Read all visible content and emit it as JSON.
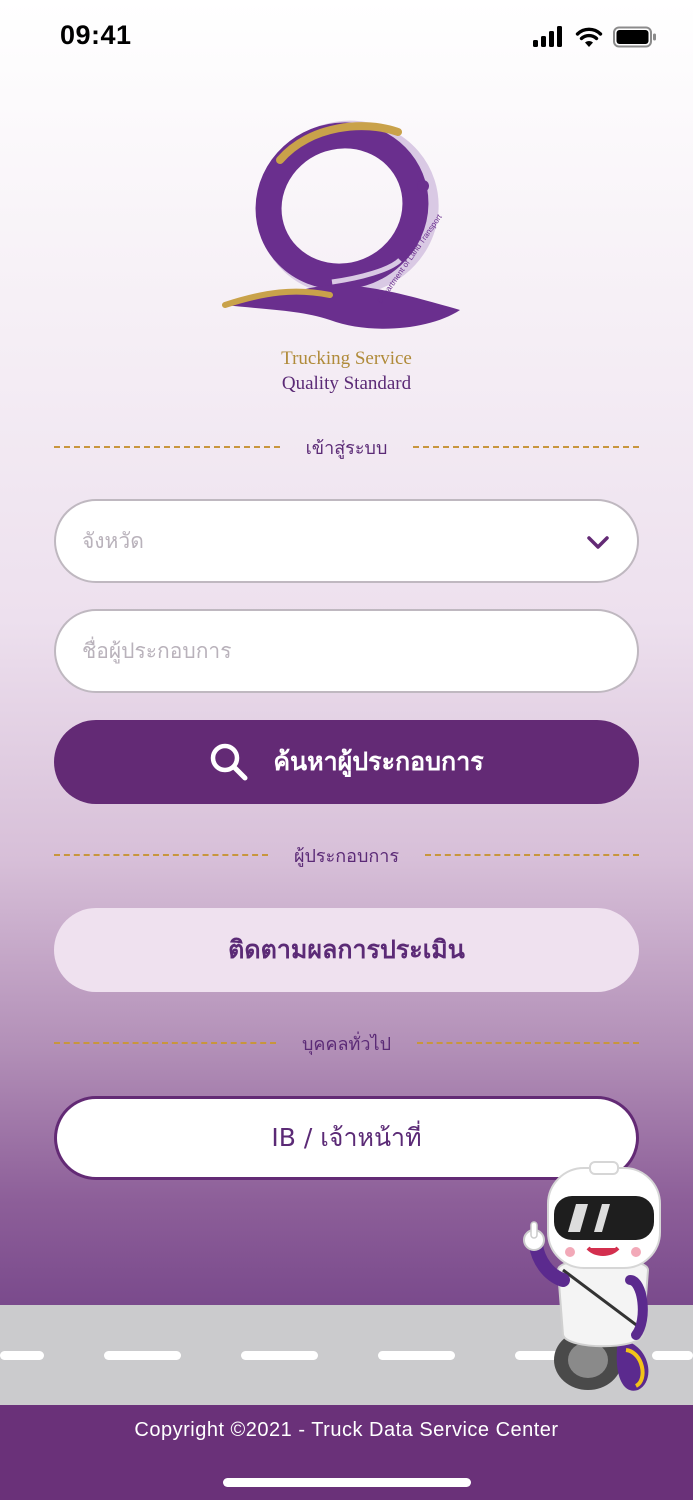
{
  "status_bar": {
    "time": "09:41"
  },
  "logo": {
    "ring_text": "Department of Land Transport",
    "caption_line1": "Trucking Service",
    "caption_line2": "Quality Standard"
  },
  "login_section": {
    "divider_label": "เข้าสู่ระบบ",
    "province_placeholder": "จังหวัด",
    "operator_placeholder": "ชื่อผู้ประกอบการ",
    "search_button_label": "ค้นหาผู้ประกอบการ"
  },
  "operator_section": {
    "divider_label": "ผู้ประกอบการ",
    "track_button_label": "ติดตามผลการประเมิน"
  },
  "public_section": {
    "divider_label": "บุคคลทั่วไป",
    "ib_button_label": "IB / เจ้าหน้าที่"
  },
  "footer": {
    "copyright": "Copyright ©2021 - Truck Data Service Center"
  },
  "colors": {
    "brand_purple": "#632a75",
    "gold": "#c8963d",
    "road": "#cbcbcd"
  },
  "icons": [
    "signal-icon",
    "wifi-icon",
    "battery-icon",
    "chevron-down-icon",
    "search-icon"
  ]
}
